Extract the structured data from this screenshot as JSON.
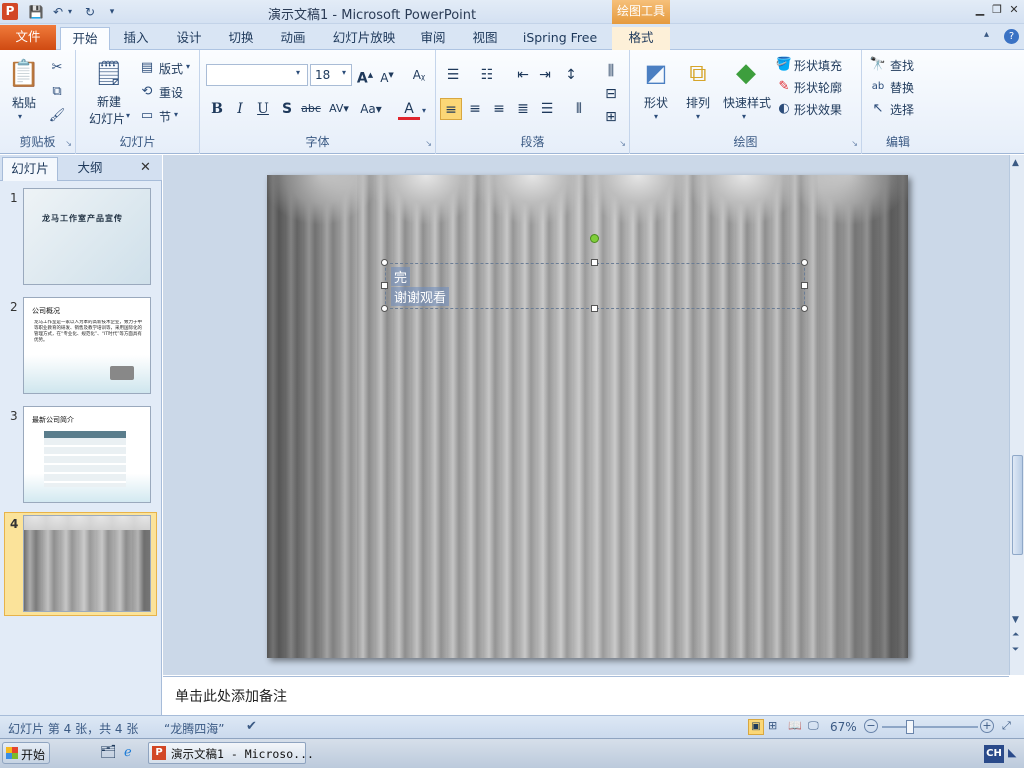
{
  "app": {
    "window_title": "演示文稿1 - Microsoft PowerPoint",
    "context_tab_header": "绘图工具"
  },
  "tabs": [
    "开始",
    "插入",
    "设计",
    "切换",
    "动画",
    "幻灯片放映",
    "审阅",
    "视图",
    "iSpring Free",
    "格式"
  ],
  "file_tab": "文件",
  "ribbon": {
    "clipboard": {
      "label": "剪贴板",
      "paste": "粘贴"
    },
    "slides": {
      "label": "幻灯片",
      "new_slide_1": "新建",
      "new_slide_2": "幻灯片",
      "layout": "版式",
      "reset": "重设",
      "section": "节"
    },
    "font": {
      "label": "字体",
      "font_name": "",
      "font_size": "18"
    },
    "paragraph": {
      "label": "段落"
    },
    "drawing": {
      "label": "绘图",
      "shapes": "形状",
      "arrange": "排列",
      "quick_styles": "快速样式",
      "shape_fill": "形状填充",
      "shape_outline": "形状轮廓",
      "shape_effects": "形状效果"
    },
    "editing": {
      "label": "编辑",
      "find": "查找",
      "replace": "替换",
      "select": "选择"
    }
  },
  "left_panel": {
    "tab_slides": "幻灯片",
    "tab_outline": "大纲",
    "close": "✕",
    "slides": [
      {
        "num": "1",
        "title": "龙马工作室产品宣传"
      },
      {
        "num": "2",
        "title": "公司概况",
        "body": "龙马工作室是一家以人为本的高新技术企业，致力于中等职业教育的研发、销售及教学培训等，采用国际化的管理方式，在“专业化、规范化”、“IT时代”等方面具有优势。"
      },
      {
        "num": "3",
        "title": "最新公司简介"
      },
      {
        "num": "4",
        "title": ""
      }
    ],
    "selected_index": "4"
  },
  "slide": {
    "line1": "完",
    "line2": "谢谢观看"
  },
  "notes_placeholder": "单击此处添加备注",
  "status": {
    "slide_info": "幻灯片 第 4 张，共 4 张",
    "theme": "“龙腾四海”",
    "zoom": "67%"
  },
  "taskbar": {
    "start": "开始",
    "task": "演示文稿1 - Microso...",
    "lang": "CH"
  },
  "colors": {
    "file_tab": "#d9541e",
    "context_tab": "#eaa24a",
    "selected_thumb": "#fbe39a"
  }
}
